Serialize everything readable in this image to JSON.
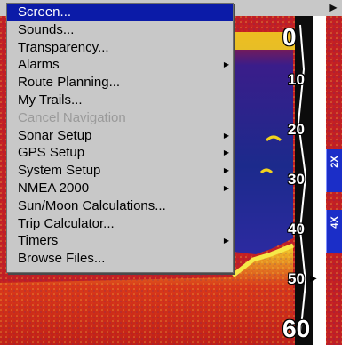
{
  "menu": {
    "items": [
      {
        "label": "Screen...",
        "selected": true,
        "disabled": false,
        "submenu": false
      },
      {
        "label": "Sounds...",
        "selected": false,
        "disabled": false,
        "submenu": false
      },
      {
        "label": "Transparency...",
        "selected": false,
        "disabled": false,
        "submenu": false
      },
      {
        "label": "Alarms",
        "selected": false,
        "disabled": false,
        "submenu": true
      },
      {
        "label": "Route Planning...",
        "selected": false,
        "disabled": false,
        "submenu": false
      },
      {
        "label": "My Trails...",
        "selected": false,
        "disabled": false,
        "submenu": false
      },
      {
        "label": "Cancel Navigation",
        "selected": false,
        "disabled": true,
        "submenu": false
      },
      {
        "label": "Sonar Setup",
        "selected": false,
        "disabled": false,
        "submenu": true
      },
      {
        "label": "GPS Setup",
        "selected": false,
        "disabled": false,
        "submenu": true
      },
      {
        "label": "System Setup",
        "selected": false,
        "disabled": false,
        "submenu": true
      },
      {
        "label": "NMEA 2000",
        "selected": false,
        "disabled": false,
        "submenu": true
      },
      {
        "label": "Sun/Moon Calculations...",
        "selected": false,
        "disabled": false,
        "submenu": false
      },
      {
        "label": "Trip Calculator...",
        "selected": false,
        "disabled": false,
        "submenu": false
      },
      {
        "label": "Timers",
        "selected": false,
        "disabled": false,
        "submenu": true
      },
      {
        "label": "Browse Files...",
        "selected": false,
        "disabled": false,
        "submenu": false
      }
    ]
  },
  "depth_scale": {
    "d0": "0",
    "d10": "10",
    "d20": "20",
    "d30": "30",
    "d40": "40",
    "d50": "50",
    "d60": "60"
  },
  "zoom_tabs": {
    "zoom_2x": "2X",
    "zoom_4x": "4X"
  },
  "icons": {
    "submenu_arrow": "▶",
    "scroll_arrow": "▶",
    "depth_end_arrow": "▶"
  },
  "colors": {
    "menu_bg": "#c8c8c8",
    "menu_selected": "#0b1ba8",
    "zoom_tab": "#1b2ec8",
    "sonar_red": "#c81e1e",
    "sonar_yellow": "#f2d21e",
    "sonar_blue": "#1e2a9a"
  }
}
